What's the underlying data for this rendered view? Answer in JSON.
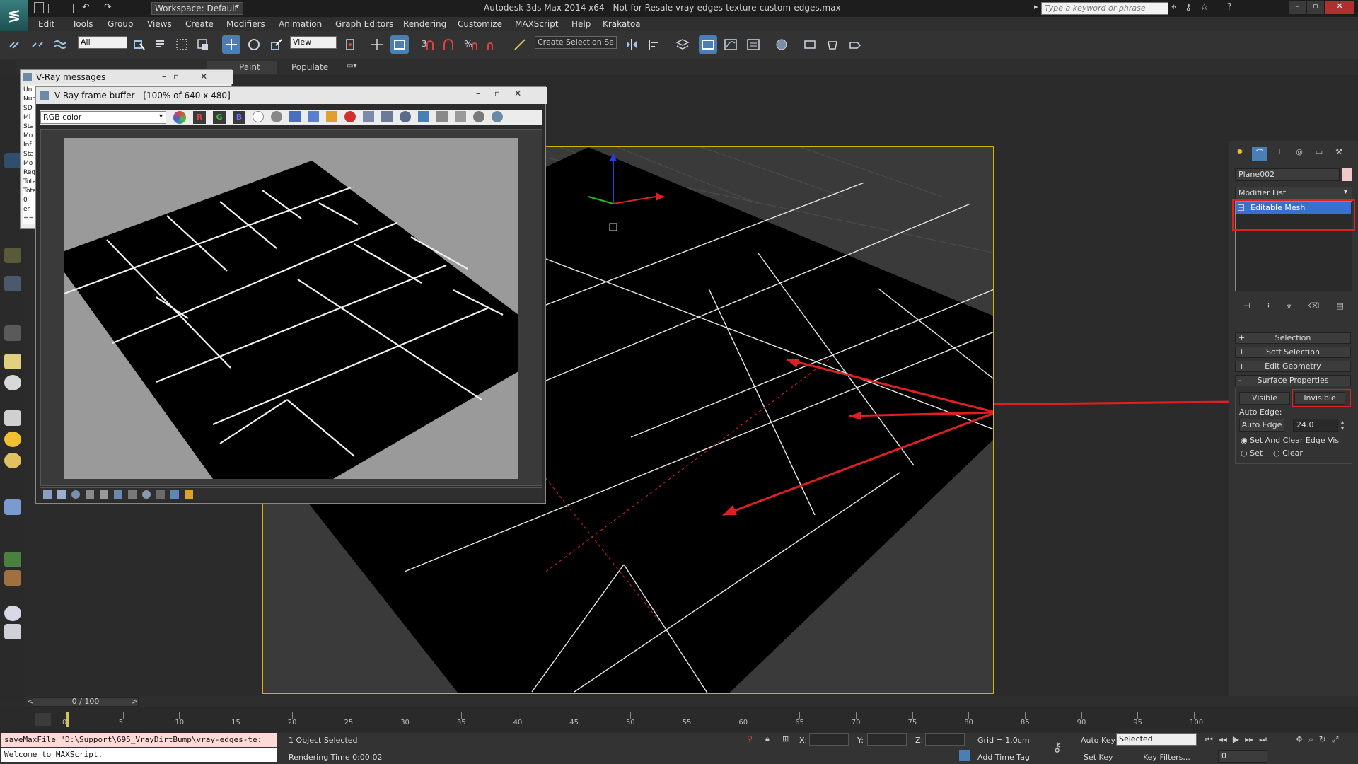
{
  "title": {
    "text": "Autodesk 3ds Max  2014 x64  - Not for Resale    vray-edges-texture-custom-edges.max",
    "workspace": "Workspace: Default",
    "search_placeholder": "Type a keyword or phrase"
  },
  "menu": [
    "Edit",
    "Tools",
    "Group",
    "Views",
    "Create",
    "Modifiers",
    "Animation",
    "Graph Editors",
    "Rendering",
    "Customize",
    "MAXScript",
    "Help",
    "Krakatoa"
  ],
  "toolbar": {
    "filter": "All",
    "ref_coord": "View",
    "selection_set": "Create Selection Se"
  },
  "ribbon": {
    "tabs": [
      "Paint",
      "Populate"
    ]
  },
  "vray_messages": {
    "title": "V-Ray messages",
    "lines": [
      "Un",
      "Nun",
      "SD",
      "Mi",
      "Sta",
      "Mo",
      "Inf",
      "Sta",
      "Mo",
      "Reg",
      "Tota",
      "Tota",
      "0 er",
      "==="
    ]
  },
  "frame_buffer": {
    "title": "V-Ray frame buffer - [100% of 640 x 480]",
    "channel": "RGB color",
    "buttons": [
      "R",
      "G",
      "B"
    ]
  },
  "command_panel": {
    "object_name": "Plane002",
    "object_color": "#f0c8c8",
    "modifier_list_label": "Modifier List",
    "stack_item": "Editable Mesh",
    "rollouts": [
      "Selection",
      "Soft Selection",
      "Edit Geometry",
      "Surface Properties"
    ],
    "visible_label": "Visible",
    "invisible_label": "Invisible",
    "auto_edge_title": "Auto Edge:",
    "auto_edge_button": "Auto Edge",
    "auto_edge_value": "24.0",
    "radio_set_clear": "Set And Clear Edge Vis",
    "radio_set": "Set",
    "radio_clear": "Clear"
  },
  "timeline": {
    "slider": "0 / 100",
    "ticks": [
      "0",
      "5",
      "10",
      "15",
      "20",
      "25",
      "30",
      "35",
      "40",
      "45",
      "50",
      "55",
      "60",
      "65",
      "70",
      "75",
      "80",
      "85",
      "90",
      "95",
      "100"
    ]
  },
  "status": {
    "maxscript_output": "saveMaxFile \"D:\\Support\\695_VrayDirtBump\\vray-edges-te:",
    "maxscript_input": "Welcome to MAXScript.",
    "selection": "1 Object Selected",
    "render_time": "Rendering Time  0:00:02",
    "x_label": "X:",
    "y_label": "Y:",
    "z_label": "Z:",
    "grid": "Grid = 1.0cm",
    "add_time_tag": "Add Time Tag",
    "auto_key": "Auto Key",
    "set_key": "Set Key",
    "key_mode": "Selected",
    "key_filters": "Key Filters...",
    "frame": "0"
  },
  "colors": {
    "viewport_border": "#c9b700",
    "annotation": "#e02020"
  }
}
